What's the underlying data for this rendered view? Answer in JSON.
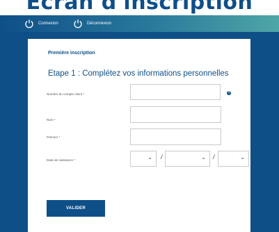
{
  "banner": {
    "text": "Écran d'inscription"
  },
  "nav": {
    "login_label": "Connexion",
    "logout_label": "Déconnexion",
    "icon": "power-icon"
  },
  "form": {
    "section_title": "Première inscription",
    "step_title": "Etape 1 : Complétez vos informations personnelles",
    "fields": {
      "client_number_label": "Numéro du compte client *",
      "name_label": "Nom *",
      "firstname_label": "Prénom *",
      "birthdate_label": "Date de naissance *"
    },
    "date_separator": "/",
    "help_icon": "question-icon",
    "submit_label": "VALIDER"
  },
  "colors": {
    "brand": "#0e4f88",
    "nav_gradient_end": "#4fa6a6"
  }
}
